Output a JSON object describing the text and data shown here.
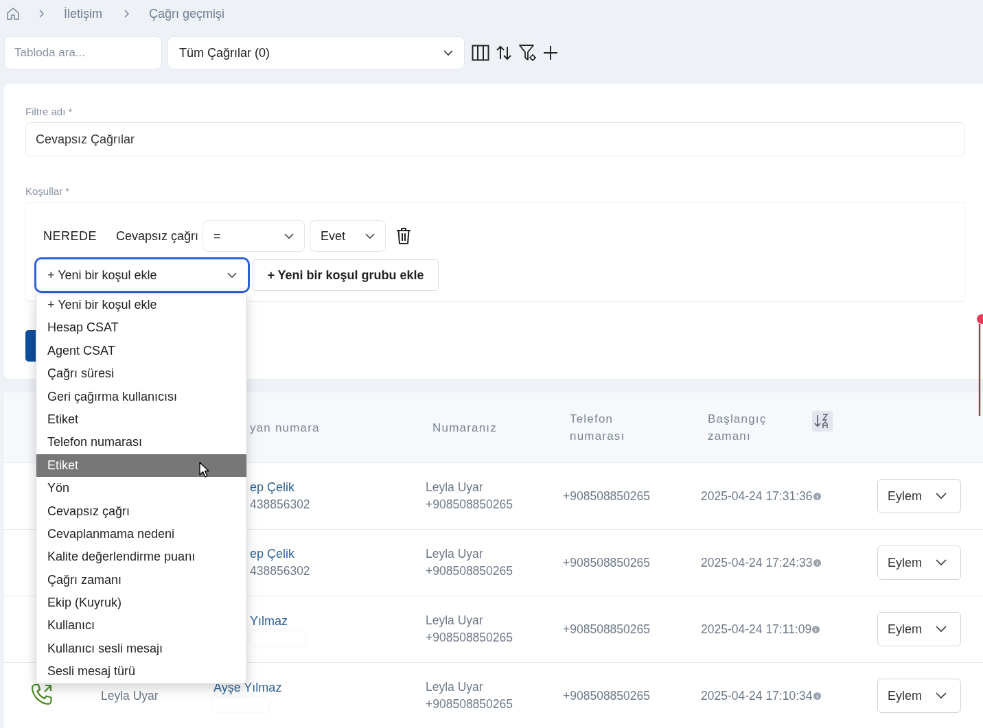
{
  "breadcrumb": [
    "İletişim",
    "Çağrı geçmişi"
  ],
  "toolbar": {
    "search": {
      "placeholder": "Tabloda ara..."
    },
    "view_select": "Tüm Çağrılar (0)"
  },
  "filter": {
    "name_label": "Filtre adı *",
    "name_value": "Cevapsız Çağrılar",
    "conditions_label": "Koşullar *",
    "condition": {
      "keyword": "NEREDE",
      "field": "Cevapsız çağrı",
      "operator": "=",
      "value": "Evet"
    },
    "add_condition": {
      "label": "+ Yeni bir koşul ekle",
      "focused": true
    },
    "add_group_button": "+ Yeni bir koşul grubu ekle",
    "dropdown": [
      {
        "label": "+ Yeni bir koşul ekle",
        "selected": false
      },
      {
        "label": "Hesap CSAT",
        "selected": false
      },
      {
        "label": "Agent CSAT",
        "selected": false
      },
      {
        "label": "Çağrı süresi",
        "selected": false
      },
      {
        "label": "Geri çağırma kullanıcısı",
        "selected": false
      },
      {
        "label": "Etiket",
        "selected": false
      },
      {
        "label": "Telefon numarası",
        "selected": false
      },
      {
        "label": "Etiket",
        "selected": true
      },
      {
        "label": "Yön",
        "selected": false
      },
      {
        "label": "Cevapsız çağrı",
        "selected": false
      },
      {
        "label": "Cevaplanmama nedeni",
        "selected": false
      },
      {
        "label": "Kalite değerlendirme puanı",
        "selected": false
      },
      {
        "label": "Çağrı zamanı",
        "selected": false
      },
      {
        "label": "Ekip (Kuyruk)",
        "selected": false
      },
      {
        "label": "Kullanıcı",
        "selected": false
      },
      {
        "label": "Kullanıcı sesli mesajı",
        "selected": false
      },
      {
        "label": "Sesli mesaj türü",
        "selected": false
      }
    ]
  },
  "table": {
    "columns": [
      "yan numara",
      "Numaranız",
      "Telefon numarası",
      "Başlangıç zamanı"
    ],
    "rows": [
      {
        "caller_name": "ep Çelik",
        "caller_number": "438856302",
        "own_name": "Leyla Uyar",
        "own_number": "+908508850265",
        "phone": "+908508850265",
        "start": "2025-04-24 17:31:36",
        "action": "Eylem"
      },
      {
        "caller_name": "ep Çelik",
        "caller_number": "438856302",
        "own_name": "Leyla Uyar",
        "own_number": "+908508850265",
        "phone": "+908508850265",
        "start": "2025-04-24 17:24:33",
        "action": "Eylem"
      },
      {
        "caller_name": "Yılmaz",
        "own_name": "Leyla Uyar",
        "own_number": "+908508850265",
        "phone": "+908508850265",
        "start": "2025-04-24 17:11:09",
        "action": "Eylem"
      },
      {
        "color": "#4a8a2a",
        "agent": "Leyla Uyar",
        "caller_name": "Ayşe Yılmaz",
        "own_name": "Leyla Uyar",
        "own_number": "+908508850265",
        "phone": "+908508850265",
        "start": "2025-04-24 17:10:34",
        "action": "Eylem"
      }
    ]
  }
}
